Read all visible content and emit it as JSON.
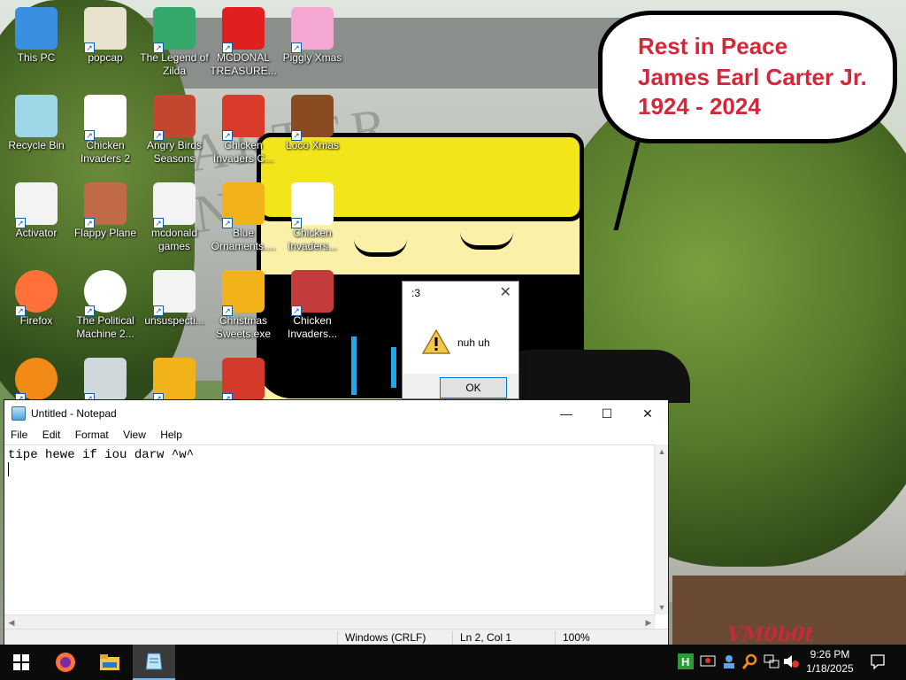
{
  "desktop": {
    "icons": [
      {
        "label": "This PC",
        "icon": "computer-icon",
        "color": "#3b8fe0"
      },
      {
        "label": "popcap",
        "icon": "folder-icon",
        "color": "#e8e2cf"
      },
      {
        "label": "The Legend of Zilda",
        "icon": "game-icon",
        "color": "#35a86b"
      },
      {
        "label": "MCDONAL TREASURE...",
        "icon": "mcdonalds-icon",
        "color": "#e02020"
      },
      {
        "label": "Piggly Xmas",
        "icon": "pig-icon",
        "color": "#f3a7d2"
      },
      {
        "label": "Recycle Bin",
        "icon": "recycle-bin-icon",
        "color": "#9fd6e8"
      },
      {
        "label": "Chicken Invaders 2",
        "icon": "chicken-icon",
        "color": "#ffffff"
      },
      {
        "label": "Angry Birds Seasons",
        "icon": "angry-birds-icon",
        "color": "#c3462e"
      },
      {
        "label": "Chicken Invaders C...",
        "icon": "snowman-icon",
        "color": "#d93a2a"
      },
      {
        "label": "Loco Xmas",
        "icon": "bear-icon",
        "color": "#8a4b22"
      },
      {
        "label": "Activator",
        "icon": "file-icon",
        "color": "#f3f3f3"
      },
      {
        "label": "Flappy Plane",
        "icon": "plane-icon",
        "color": "#c06a48"
      },
      {
        "label": "mcdonald games",
        "icon": "file-icon",
        "color": "#f3f3f3"
      },
      {
        "label": "Blue Ornaments....",
        "icon": "popcap-ornament-icon",
        "color": "#f2b21a"
      },
      {
        "label": "Chicken Invaders...",
        "icon": "chicken-santa-icon",
        "color": "#ffffff"
      },
      {
        "label": "Firefox",
        "icon": "firefox-icon",
        "color": "#ff7139"
      },
      {
        "label": "The Political Machine 2...",
        "icon": "political-machine-icon",
        "color": "#ffffff"
      },
      {
        "label": "unsuspecti...",
        "icon": "file-icon",
        "color": "#f3f3f3"
      },
      {
        "label": "Christmas Sweets.exe",
        "icon": "popcap-ornament-icon",
        "color": "#f2b21a"
      },
      {
        "label": "Chicken Invaders...",
        "icon": "chicken-ship-icon",
        "color": "#c43b3b"
      },
      {
        "label": "",
        "icon": "orange-ring-icon",
        "color": "#f28b16"
      },
      {
        "label": "",
        "icon": "photo-icon",
        "color": "#cfd9dc"
      },
      {
        "label": "",
        "icon": "popcap-ornament-icon",
        "color": "#f2b21a"
      },
      {
        "label": "",
        "icon": "game-icon",
        "color": "#d33a2a"
      }
    ]
  },
  "bubble": {
    "line1": "Rest in Peace",
    "line2": "James Earl Carter Jr.",
    "line3": "1924 - 2024",
    "color": "#d4283a"
  },
  "msgbox": {
    "title": ":3",
    "message": "nuh uh",
    "ok_label": "OK",
    "icon": "warning-icon"
  },
  "notepad": {
    "title": "Untitled - Notepad",
    "menu": [
      "File",
      "Edit",
      "Format",
      "View",
      "Help"
    ],
    "content": "tipe hewe if iou darw ^w^",
    "status_encoding": "Windows (CRLF)",
    "status_position": "Ln 2, Col 1",
    "status_zoom": "100%"
  },
  "taskbar": {
    "buttons": [
      "start-button",
      "firefox-icon",
      "file-explorer-icon",
      "notepad-icon"
    ],
    "time": "9:26 PM",
    "date": "1/18/2025"
  },
  "watermark": "VM0b0t"
}
